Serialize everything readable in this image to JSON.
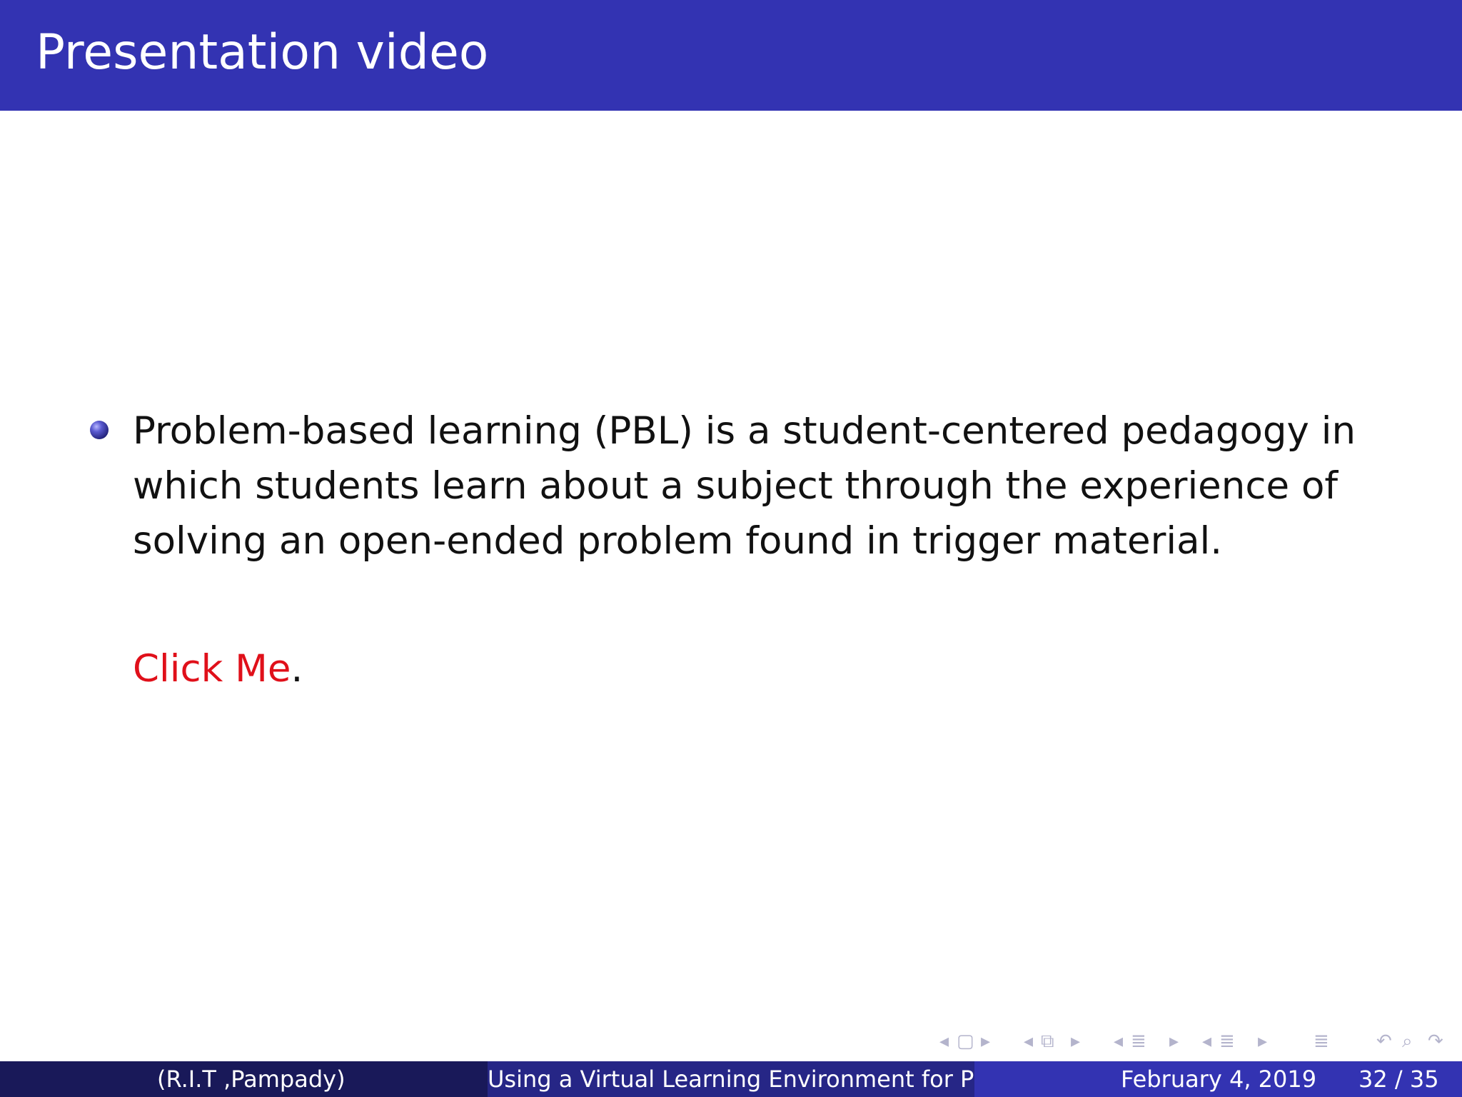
{
  "slide": {
    "title": "Presentation video",
    "bullet": "Problem-based learning (PBL) is a student-centered pedagogy in which students learn about a subject through the experience of solving an open-ended problem found in trigger material.",
    "link_label": "Click Me",
    "link_suffix": "."
  },
  "colors": {
    "title_bar": "#3333b2",
    "link": "#e0101a",
    "footer_left": "#191959",
    "footer_mid": "#262686",
    "footer_right": "#3333b2"
  },
  "navigation": {
    "icons": [
      "prev-arrow",
      "frame-icon",
      "next-arrow",
      "prev-arrow",
      "slides-icon",
      "next-arrow",
      "prev-arrow",
      "section-icon",
      "next-arrow",
      "prev-arrow",
      "subsection-icon",
      "next-arrow",
      "align-icon",
      "back-icon",
      "search-icon",
      "redo-icon"
    ]
  },
  "footer": {
    "institute": "(R.I.T ,Pampady)",
    "short_title": "Using a Virtual Learning Environment for Pro",
    "date": "February 4, 2019",
    "page": "32 / 35"
  }
}
